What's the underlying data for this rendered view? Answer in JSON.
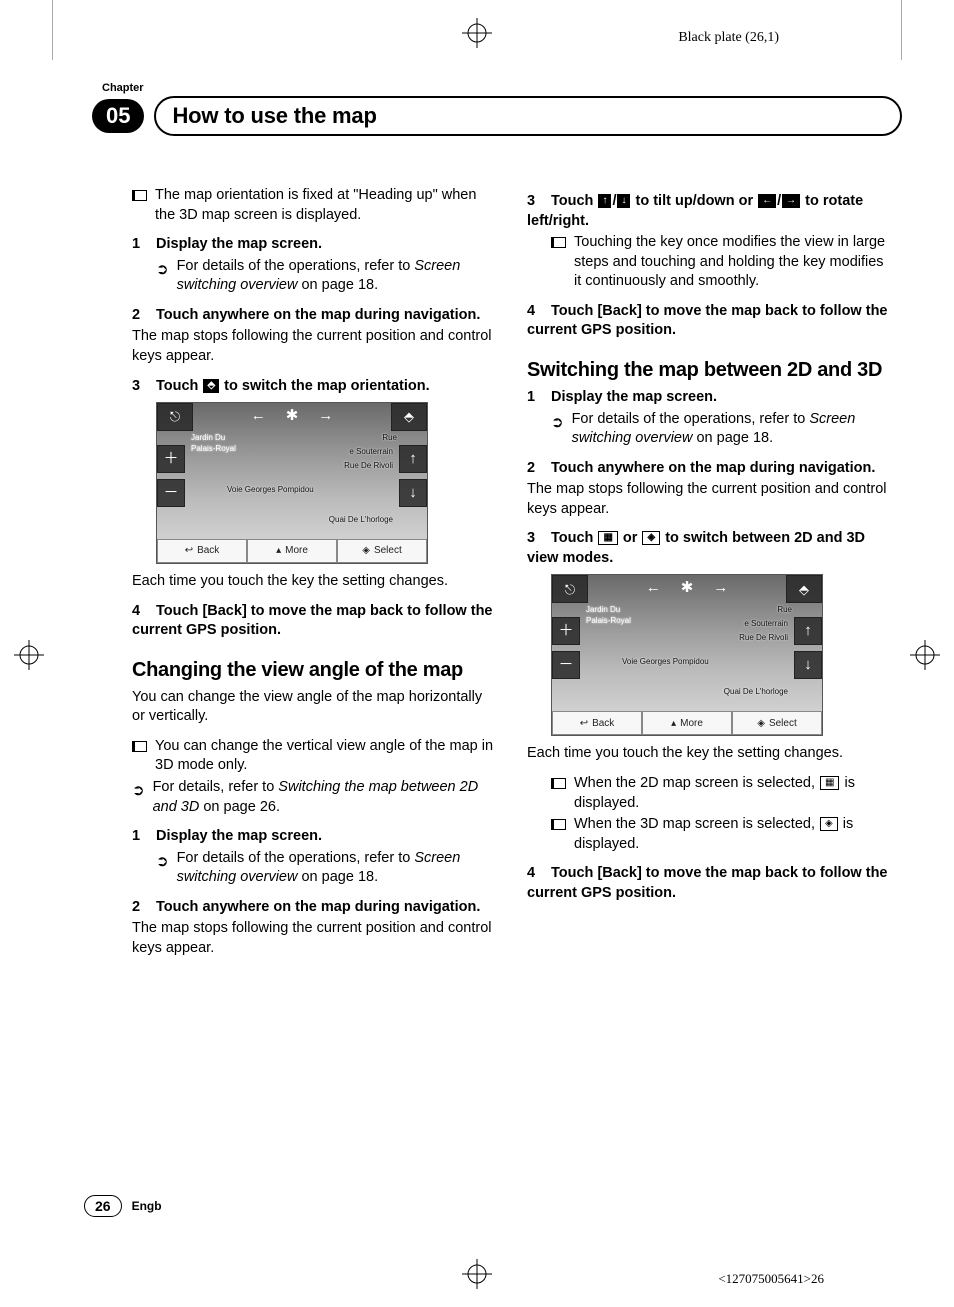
{
  "black_plate": "Black plate (26,1)",
  "chapter_label": "Chapter",
  "chapter_number": "05",
  "title": "How to use the map",
  "col1": {
    "intro_bullet": "The map orientation is fixed at \"Heading up\" when the 3D map screen is displayed.",
    "s1_head": "Display the map screen.",
    "s1_ref_a": "For details of the operations, refer to ",
    "s1_ref_b": "Screen switching overview",
    "s1_ref_c": " on page 18.",
    "s2_head": "Touch anywhere on the map during navigation.",
    "s2_body": "The map stops following the current position and control keys appear.",
    "s3_head_a": "Touch ",
    "s3_head_b": " to switch the map orientation.",
    "after_map": "Each time you touch the key the setting changes.",
    "s4_head": "Touch [Back] to move the map back to follow the current GPS position.",
    "h2": "Changing the view angle of the map",
    "h2_intro": "You can change the view angle of the map horizontally or vertically.",
    "h2_b1": "You can change the vertical view angle of the map in 3D mode only.",
    "h2_ref_a": "For details, refer to ",
    "h2_ref_b": "Switching the map between 2D and 3D",
    "h2_ref_c": " on page 26.",
    "c1_head": "Display the map screen.",
    "c1_ref_a": "For details of the operations, refer to ",
    "c1_ref_b": "Screen switching overview",
    "c1_ref_c": " on page 18.",
    "c2_head": "Touch anywhere on the map during navigation.",
    "c2_body": "The map stops following the current position and control keys appear."
  },
  "col2": {
    "s3_head_a": "Touch ",
    "s3_head_b": " to tilt up/down or ",
    "s3_head_c": " to rotate left/right.",
    "s3_bullet": "Touching the key once modifies the view in large steps and touching and holding the key modifies it continuously and smoothly.",
    "s4_head": "Touch [Back] to move the map back to follow the current GPS position.",
    "h2": "Switching the map between 2D and 3D",
    "d1_head": "Display the map screen.",
    "d1_ref_a": "For details of the operations, refer to ",
    "d1_ref_b": "Screen switching overview",
    "d1_ref_c": " on page 18.",
    "d2_head": "Touch anywhere on the map during navigation.",
    "d2_body": "The map stops following the current position and control keys appear.",
    "d3_head_a": "Touch ",
    "d3_head_b": " or ",
    "d3_head_c": " to switch between 2D and 3D view modes.",
    "after_map": "Each time you touch the key the setting changes.",
    "e_b1_a": "When the 2D map screen is selected, ",
    "e_b1_b": " is displayed.",
    "e_b2_a": "When the 3D map screen is selected, ",
    "e_b2_b": " is displayed.",
    "e4_head": "Touch [Back] to move the map back to follow the current GPS position."
  },
  "map": {
    "place1": "Jardin Du",
    "place1b": "Palais-Royal",
    "st1": "e Souterrain",
    "st2": "Rue De Rivoli",
    "st3": "Voie Georges Pompidou",
    "st4": "Quai De L'horloge",
    "st5": "Rue",
    "back": "Back",
    "more": "More",
    "select": "Select"
  },
  "icons": {
    "up": "↑",
    "down": "↓",
    "left": "←",
    "right": "→",
    "slash": "/",
    "compass_small": "⬘",
    "view2d": "▦",
    "view3d": "◈"
  },
  "footer": {
    "page": "26",
    "lang": "Engb",
    "print_id": "<127075005641>26"
  },
  "step_labels": {
    "n1": "1",
    "n2": "2",
    "n3": "3",
    "n4": "4"
  }
}
